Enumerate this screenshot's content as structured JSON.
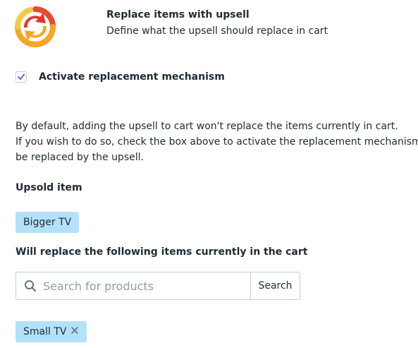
{
  "header": {
    "title": "Replace items with upsell",
    "subtitle": "Define what the upsell should replace in cart",
    "icon": "replace-arrows-icon"
  },
  "activate": {
    "label": "Activate replacement mechanism",
    "checked": true
  },
  "description": {
    "line1": "By default, adding the upsell to cart won't replace the items currently in cart.",
    "line2": "If you wish to do so, check the box above to activate the replacement mechanism and select the items that should",
    "line3": "be replaced by the upsell."
  },
  "upsold": {
    "label": "Upsold item",
    "item": "Bigger TV"
  },
  "replace": {
    "label": "Will replace the following items currently in the cart",
    "search_placeholder": "Search for products",
    "search_button": "Search",
    "items": [
      "Small TV"
    ]
  },
  "colors": {
    "tag_bg": "#b4e1fa",
    "checkbox_check": "#5c6ac4",
    "icon_orange": "#f5a623",
    "icon_red": "#e8322f"
  }
}
